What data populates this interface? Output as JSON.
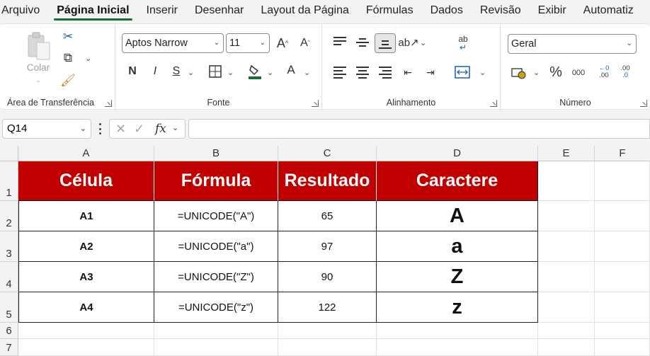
{
  "menu": {
    "tabs": [
      "Arquivo",
      "Página Inicial",
      "Inserir",
      "Desenhar",
      "Layout da Página",
      "Fórmulas",
      "Dados",
      "Revisão",
      "Exibir",
      "Automatiz"
    ]
  },
  "ribbon": {
    "clipboard": {
      "paste_label": "Colar",
      "group_label": "Área de Transferência"
    },
    "font": {
      "font_name": "Aptos Narrow",
      "font_size": "11",
      "group_label": "Fonte",
      "bold": "N",
      "italic": "I",
      "underline": "S",
      "grow": "A",
      "shrink": "A",
      "font_color": "A"
    },
    "alignment": {
      "group_label": "Alinhamento",
      "wrap": "ab"
    },
    "number": {
      "format": "Geral",
      "group_label": "Número",
      "percent": "%",
      "thousands": "000",
      "inc_decimal": ".00",
      "dec_decimal": ".0"
    }
  },
  "formula_bar": {
    "name_box": "Q14",
    "fx": "fx",
    "value": ""
  },
  "columns": [
    "A",
    "B",
    "C",
    "D",
    "E",
    "F"
  ],
  "rows": [
    "1",
    "2",
    "3",
    "4",
    "5",
    "6",
    "7"
  ],
  "table": {
    "headers": [
      "Célula",
      "Fórmula",
      "Resultado",
      "Caractere"
    ],
    "rows": [
      [
        "A1",
        "=UNICODE(\"A\")",
        "65",
        "A"
      ],
      [
        "A2",
        "=UNICODE(\"a\")",
        "97",
        "a"
      ],
      [
        "A3",
        "=UNICODE(\"Z\")",
        "90",
        "Z"
      ],
      [
        "A4",
        "=UNICODE(\"z\")",
        "122",
        "z"
      ]
    ]
  },
  "colors": {
    "header_fill": "#c00000",
    "accent": "#1e6b3a"
  }
}
